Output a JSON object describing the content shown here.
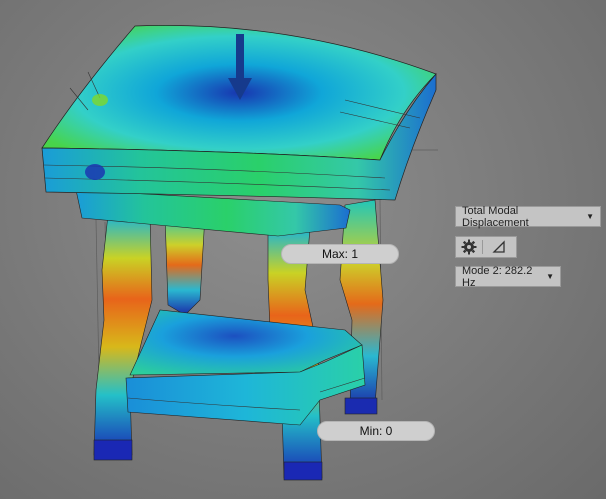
{
  "result_panel": {
    "result_type": "Total Modal Displacement",
    "mode_selector": "Mode 2: 282.2 Hz"
  },
  "probes": {
    "max_label": "Max: 1",
    "min_label": "Min: 0"
  },
  "icons": {
    "settings": "gear-icon",
    "probe": "triangle-probe-icon",
    "load": "load-arrow-icon"
  },
  "colors": {
    "background": "#7d7d7d",
    "contour_low": "#1a2bb8",
    "contour_mid": "#2bd06a",
    "contour_high": "#e05a12",
    "load_arrow": "#163a8c"
  }
}
